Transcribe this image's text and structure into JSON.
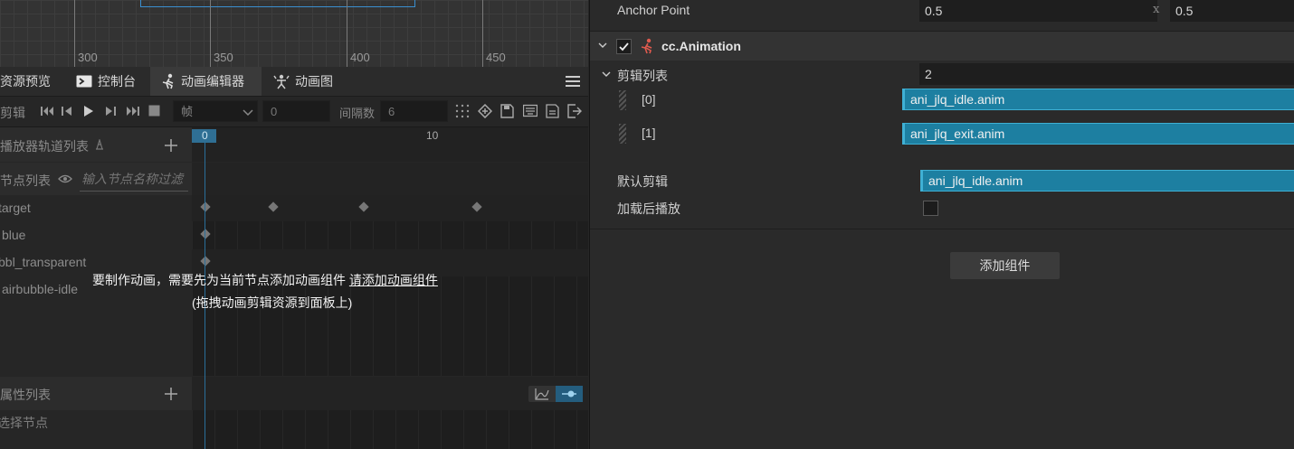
{
  "scene": {
    "ruler_labels": [
      "300",
      "350",
      "400",
      "450"
    ]
  },
  "tabs": [
    {
      "label": "资源预览",
      "icon": "assets-preview-icon"
    },
    {
      "label": "控制台",
      "icon": "console-icon"
    },
    {
      "label": "动画编辑器",
      "icon": "animation-editor-icon"
    },
    {
      "label": "动画图",
      "icon": "animation-graph-icon"
    }
  ],
  "toolbar": {
    "clip_label": "剪辑",
    "unit_select": "帧",
    "frame_value": "0",
    "interval_label": "间隔数",
    "interval_value": "6"
  },
  "track_list": {
    "header": "播放器轨道列表",
    "node_list_label": "节点列表",
    "node_filter_placeholder": "输入节点名称过滤",
    "nodes": [
      "target",
      "blue",
      "bbl_transparent",
      "airbubble-idle"
    ],
    "property_list_label": "属性列表",
    "select_node_hint": "选择节点"
  },
  "timeline": {
    "ruler_labels": [
      "0",
      "10"
    ]
  },
  "notice": {
    "line1_prefix": "要制作动画，需要先为当前节点添加动画组件",
    "line1_link": "请添加动画组件",
    "line2": "(拖拽动画剪辑资源到面板上)"
  },
  "inspector": {
    "anchor_point": {
      "label": "Anchor Point",
      "x": "0.5",
      "x_sep": "x",
      "y": "0.5"
    },
    "component": {
      "name": "cc.Animation",
      "enabled": true
    },
    "clips": {
      "label": "剪辑列表",
      "count": "2",
      "items": [
        {
          "index": "[0]",
          "value": "ani_jlq_idle.anim"
        },
        {
          "index": "[1]",
          "value": "ani_jlq_exit.anim"
        }
      ]
    },
    "default_clip": {
      "label": "默认剪辑",
      "value": "ani_jlq_idle.anim"
    },
    "play_on_load": {
      "label": "加载后播放",
      "checked": false
    },
    "add_component_button": "添加组件"
  }
}
